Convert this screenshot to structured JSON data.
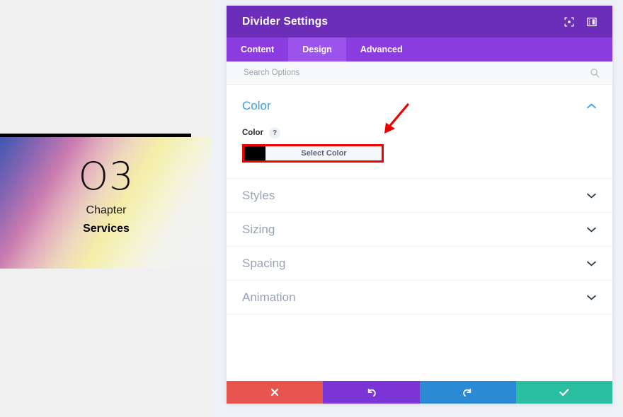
{
  "canvas": {
    "divider": {
      "name": "divider-line",
      "color": "#000000"
    },
    "gradient": {
      "stops": [
        "#3c58b2",
        "#865fb0",
        "#c46ea8",
        "#f6ec7c",
        "#ffffff"
      ]
    },
    "chapter": {
      "number": "O3",
      "word": "Chapter",
      "title": "Services"
    }
  },
  "modal": {
    "title": "Divider Settings",
    "titlebar_icons": [
      {
        "name": "focus-icon",
        "glyph": "focus"
      },
      {
        "name": "layout-icon",
        "glyph": "layout"
      }
    ],
    "tabs": [
      {
        "label": "Content",
        "active": false
      },
      {
        "label": "Design",
        "active": true
      },
      {
        "label": "Advanced",
        "active": false
      }
    ],
    "search": {
      "placeholder": "Search Options",
      "value": "",
      "icon": "search-icon"
    },
    "sections": [
      {
        "id": "color",
        "title": "Color",
        "expanded": true,
        "title_color": "#3b9fe8",
        "chevron": "chevron-up-icon",
        "fields": [
          {
            "label": "Color",
            "help": "?",
            "swatch_color": "#000000",
            "button_label": "Select Color",
            "highlighted": true,
            "highlight_color": "#ef0000"
          }
        ]
      },
      {
        "id": "styles",
        "title": "Styles",
        "expanded": false,
        "chevron": "chevron-down-icon"
      },
      {
        "id": "sizing",
        "title": "Sizing",
        "expanded": false,
        "chevron": "chevron-down-icon"
      },
      {
        "id": "spacing",
        "title": "Spacing",
        "expanded": false,
        "chevron": "chevron-down-icon"
      },
      {
        "id": "animation",
        "title": "Animation",
        "expanded": false,
        "chevron": "chevron-down-icon"
      }
    ],
    "footer": [
      {
        "id": "cancel",
        "icon": "close-icon",
        "color": "#e8554e"
      },
      {
        "id": "undo",
        "icon": "undo-icon",
        "color": "#7b35d6"
      },
      {
        "id": "redo",
        "icon": "redo-icon",
        "color": "#2a8ad4"
      },
      {
        "id": "save",
        "icon": "check-icon",
        "color": "#2bbfa2"
      }
    ]
  },
  "annotation": {
    "arrow": {
      "name": "annotation-arrow",
      "color": "#ef0000",
      "direction": "down-left"
    }
  }
}
